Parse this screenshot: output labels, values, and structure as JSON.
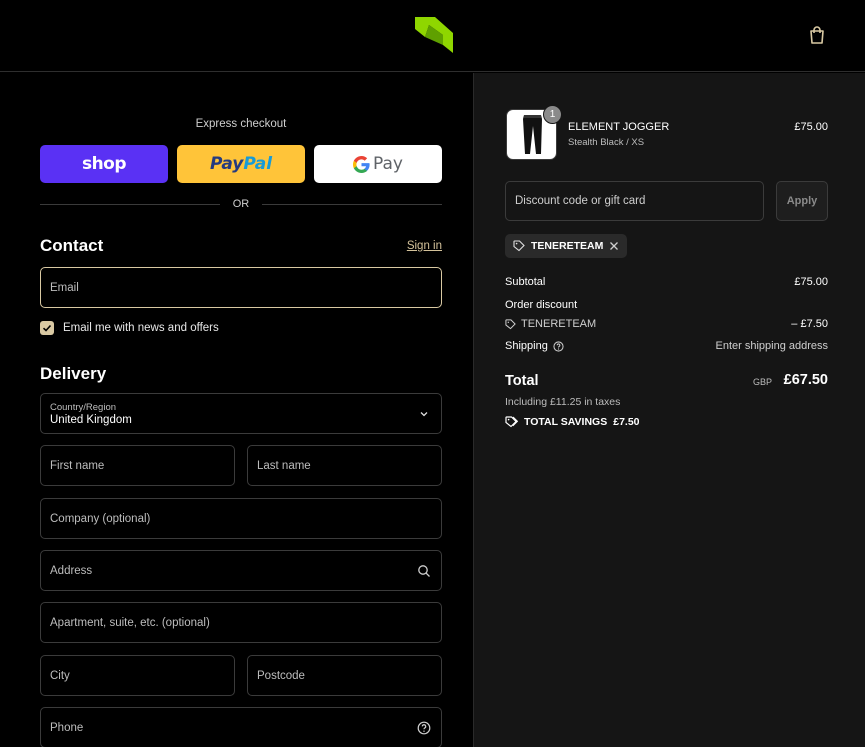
{
  "header": {
    "logo_icon": "brand-logo-icon",
    "cart_icon": "shopping-bag-icon"
  },
  "express": {
    "label": "Express checkout",
    "shop_pay_label": "shop",
    "paypal_label_1": "Pay",
    "paypal_label_2": "Pal",
    "gpay_label": "Pay",
    "or_label": "OR"
  },
  "contact": {
    "title": "Contact",
    "sign_in": "Sign in",
    "email_placeholder": "Email",
    "newsletter_label": "Email me with news and offers",
    "newsletter_checked": true
  },
  "delivery": {
    "title": "Delivery",
    "country_label": "Country/Region",
    "country_value": "United Kingdom",
    "first_name_placeholder": "First name",
    "last_name_placeholder": "Last name",
    "company_placeholder": "Company (optional)",
    "address_placeholder": "Address",
    "apartment_placeholder": "Apartment, suite, etc. (optional)",
    "city_placeholder": "City",
    "postcode_placeholder": "Postcode",
    "phone_placeholder": "Phone"
  },
  "summary": {
    "product": {
      "quantity": "1",
      "name": "ELEMENT JOGGER",
      "variant": "Stealth Black / XS",
      "price": "£75.00"
    },
    "discount_placeholder": "Discount code or gift card",
    "apply_label": "Apply",
    "applied_code": "TENERETEAM",
    "subtotal_label": "Subtotal",
    "subtotal_value": "£75.00",
    "order_discount_label": "Order discount",
    "discount_code": "TENERETEAM",
    "discount_value": "– £7.50",
    "shipping_label": "Shipping",
    "shipping_value": "Enter shipping address",
    "total_label": "Total",
    "currency": "GBP",
    "total_value": "£67.50",
    "taxes_note": "Including £11.25 in taxes",
    "savings_label": "TOTAL SAVINGS",
    "savings_value": "£7.50"
  },
  "colors": {
    "background": "#000000",
    "summary_bg": "#151515",
    "accent": "#d9c9a3",
    "brand_green": "#8fd600",
    "shop_pay": "#5a31f4",
    "paypal": "#ffc439"
  }
}
